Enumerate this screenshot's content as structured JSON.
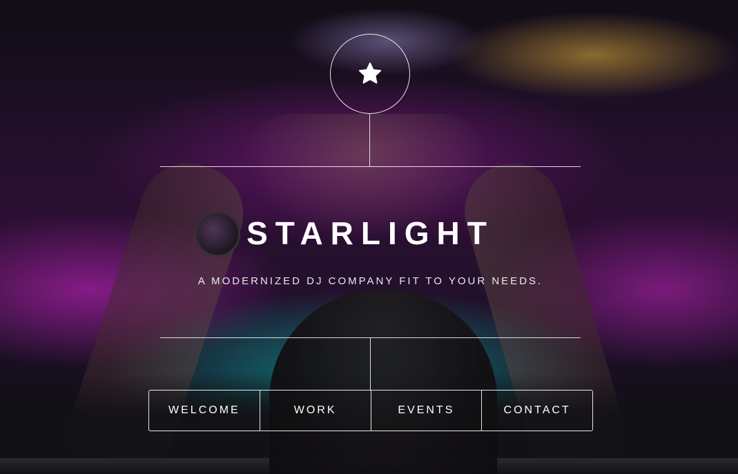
{
  "header": {
    "logo_icon": "star-icon",
    "title": "STARLIGHT",
    "subtitle": "A MODERNIZED DJ COMPANY FIT TO YOUR NEEDS."
  },
  "nav": {
    "items": [
      {
        "label": "WELCOME"
      },
      {
        "label": "WORK"
      },
      {
        "label": "EVENTS"
      },
      {
        "label": "CONTACT"
      }
    ]
  },
  "colors": {
    "text": "#ffffff",
    "accent_magenta": "#c828c8",
    "accent_cyan": "#14bebe"
  }
}
